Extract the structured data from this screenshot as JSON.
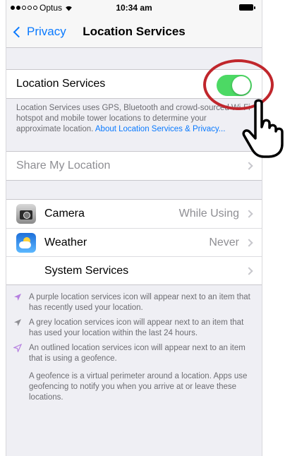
{
  "status_bar": {
    "carrier": "Optus",
    "time": "10:34 am"
  },
  "nav": {
    "back_label": "Privacy",
    "title": "Location Services"
  },
  "location_toggle": {
    "label": "Location Services",
    "on": true,
    "description": "Location Services uses GPS, Bluetooth and crowd-sourced Wi-Fi hotspot and mobile tower locations to determine your approximate location.",
    "link": "About Location Services & Privacy..."
  },
  "share": {
    "label": "Share My Location"
  },
  "apps": [
    {
      "name": "Camera",
      "value": "While Using",
      "icon": "camera-icon"
    },
    {
      "name": "Weather",
      "value": "Never",
      "icon": "weather-icon"
    },
    {
      "name": "System Services",
      "value": "",
      "icon": ""
    }
  ],
  "footnotes": [
    {
      "color": "#b67fe0",
      "style": "purple-filled",
      "text": "A purple location services icon will appear next to an item that has recently used your location."
    },
    {
      "color": "#8e8e93",
      "style": "grey-filled",
      "text": "A grey location services icon will appear next to an item that has used your location within the last 24 hours."
    },
    {
      "color": "#b67fe0",
      "style": "outlined",
      "text": "An outlined location services icon will appear next to an item that is using a geofence."
    }
  ],
  "geofence_text": "A geofence is a virtual perimeter around a location. Apps use geofencing to notify you when you arrive at or leave these locations.",
  "colors": {
    "accent": "#0a7aff",
    "toggle_on": "#4cd964",
    "annotation": "#c0262c"
  }
}
